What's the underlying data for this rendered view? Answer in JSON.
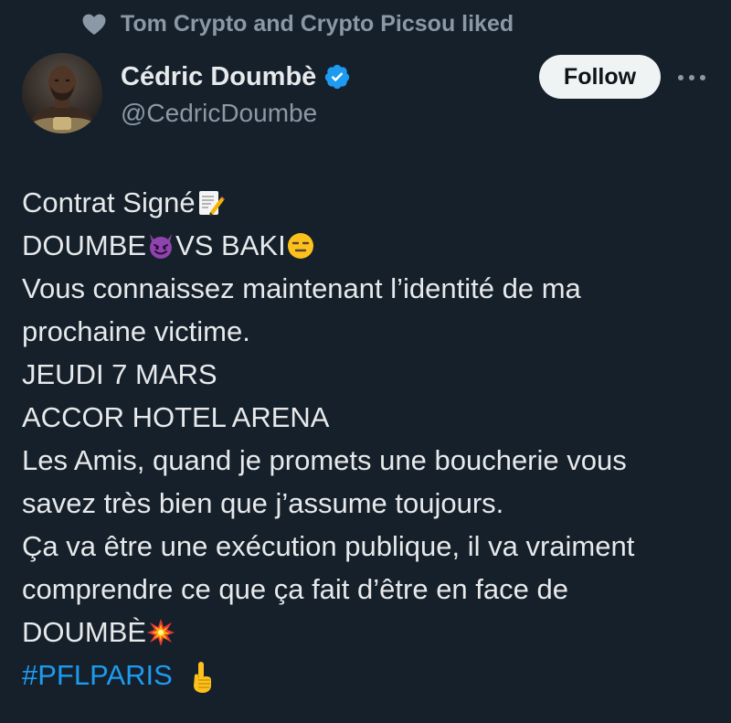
{
  "social_context": {
    "text": "Tom Crypto and Crypto Picsou liked",
    "icon": "heart-icon"
  },
  "author": {
    "name": "Cédric Doumbè",
    "handle": "@CedricDoumbe",
    "verified_icon": "verified-badge-icon"
  },
  "actions": {
    "follow_label": "Follow",
    "more_icon": "more-options-icon"
  },
  "tweet": {
    "lines": [
      {
        "text": "Contrat Signé ",
        "emoji_after": "memo-emoji"
      },
      {
        "text": "DOUMBE ",
        "emoji_mid": "smiling-devil-emoji",
        "text_after": "VS BAKI ",
        "emoji_after": "expressionless-face-emoji"
      },
      {
        "text": "Vous connaissez maintenant l’identité de ma"
      },
      {
        "text": "prochaine victime."
      },
      {
        "text": "JEUDI 7 MARS"
      },
      {
        "text": "ACCOR HOTEL ARENA"
      },
      {
        "text": "Les Amis, quand je promets une boucherie vous"
      },
      {
        "text": "savez très bien que j’assume toujours."
      },
      {
        "text": "Ça va être une exécution publique, il va vraiment"
      },
      {
        "text": "comprendre ce que ça fait d’être en face de"
      },
      {
        "text": "DOUMBÈ",
        "emoji_after": "collision-emoji"
      }
    ],
    "hashtag": "#PFLPARIS",
    "hashtag_emoji": "pointing-up-emoji"
  },
  "colors": {
    "background": "#15202b",
    "text_primary": "#e7e9ea",
    "text_secondary": "#8b98a5",
    "link": "#1d9bf0",
    "verified": "#1d9bf0",
    "follow_bg": "#eff3f4"
  }
}
